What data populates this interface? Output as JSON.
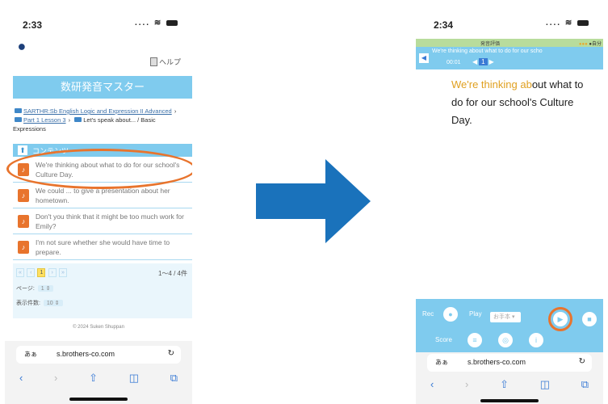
{
  "left_phone": {
    "status": {
      "time": "2:33"
    },
    "help_label": "ヘルプ",
    "app_title": "数研発音マスター",
    "breadcrumb": {
      "parts": [
        "SARTHR:Sb English Logic and Expression II Advanced",
        "Part 1 Lesson 3",
        "Let's speak about... / Basic Expressions"
      ]
    },
    "list_header": "コンテンツ",
    "items": [
      "We're thinking about what to do for our school's Culture Day.",
      "We could ... to give a presentation about her hometown.",
      "Don't you think that it might be too much work for Emily?",
      "I'm not sure whether she would have time to prepare."
    ],
    "pager": {
      "page_labels": [
        "«",
        "‹",
        "1",
        "›",
        "»"
      ],
      "count": "1～4 / 4件"
    },
    "page_select": {
      "label": "ページ:",
      "value": "1"
    },
    "per_page": {
      "label": "表示件数:",
      "value": "10"
    },
    "copyright": "© 2024 Suken Shuppan",
    "browser": {
      "aa": "あぁ",
      "url": "s.brothers-co.com",
      "reload": "↻"
    }
  },
  "right_phone": {
    "status": {
      "time": "2:34"
    },
    "header_label": "発音評価",
    "header_indicator": "●自分",
    "sentence_line": "We're thinking about what to do for our scho",
    "time": "00:01",
    "page_current": "1",
    "text_said": "We're thinking ab",
    "text_current": "out what to do for our school's Culture Day.",
    "text_next": "",
    "controls": {
      "rec_label": "Rec",
      "play_label": "Play",
      "speed_value": "お手本",
      "score_label": "Score"
    },
    "browser": {
      "aa": "あぁ",
      "url": "s.brothers-co.com",
      "reload": "↻"
    }
  },
  "colors": {
    "accent_blue": "#7fcbee",
    "highlight_orange": "#e8742d",
    "arrow_blue": "#1a72bb",
    "header_green": "#b8dc9c"
  }
}
